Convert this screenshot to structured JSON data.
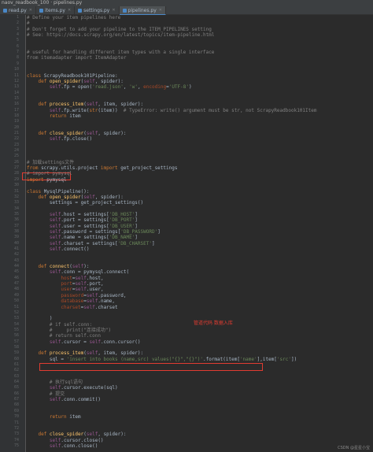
{
  "window": {
    "title": "naov_readbook_100  ·  pipelines.py"
  },
  "tabs": [
    {
      "label": "read.py",
      "active": false
    },
    {
      "label": "items.py",
      "active": false
    },
    {
      "label": "settings.py",
      "active": false
    },
    {
      "label": "pipelines.py",
      "active": true
    }
  ],
  "annotation": "管道代码 数据入库",
  "watermark": "CSDN @星星小宝",
  "lines": [
    {
      "n": "1",
      "t": [
        [
          "cmt",
          "# Define your item pipelines here"
        ]
      ]
    },
    {
      "n": "2",
      "t": [
        [
          "cmt",
          "#"
        ]
      ]
    },
    {
      "n": "3",
      "t": [
        [
          "cmt",
          "# Don't forget to add your pipeline to the ITEM_PIPELINES setting"
        ]
      ]
    },
    {
      "n": "4",
      "t": [
        [
          "cmt",
          "# See: https://docs.scrapy.org/en/latest/topics/item-pipeline.html"
        ]
      ]
    },
    {
      "n": "5",
      "t": []
    },
    {
      "n": "6",
      "t": []
    },
    {
      "n": "7",
      "t": [
        [
          "cmt",
          "# useful for handling different item types with a single interface"
        ]
      ]
    },
    {
      "n": "8",
      "t": [
        [
          "cmt",
          "from itemadapter import ItemAdapter"
        ]
      ]
    },
    {
      "n": "9",
      "t": []
    },
    {
      "n": "10",
      "t": []
    },
    {
      "n": "11",
      "t": [
        [
          "kw",
          "class "
        ],
        [
          "",
          "ScrapyReadbook101Pipeline:"
        ]
      ]
    },
    {
      "n": "12",
      "t": [
        [
          "",
          "    "
        ],
        [
          "kw",
          "def "
        ],
        [
          "fn",
          "open_spider"
        ],
        [
          "",
          "("
        ],
        [
          "slf",
          "self"
        ],
        [
          "",
          ", spider):"
        ]
      ]
    },
    {
      "n": "13",
      "t": [
        [
          "",
          "        "
        ],
        [
          "slf",
          "self"
        ],
        [
          "",
          ".fp = open("
        ],
        [
          "str",
          "'read.json'"
        ],
        [
          "",
          ", "
        ],
        [
          "str",
          "'w'"
        ],
        [
          "",
          ", "
        ],
        [
          "kwarg",
          "encoding"
        ],
        [
          "",
          "="
        ],
        [
          "str",
          "'UTF-8'"
        ],
        [
          "",
          ")"
        ]
      ]
    },
    {
      "n": "14",
      "t": []
    },
    {
      "n": "15",
      "t": []
    },
    {
      "n": "16",
      "t": [
        [
          "",
          "    "
        ],
        [
          "kw",
          "def "
        ],
        [
          "fn",
          "process_item"
        ],
        [
          "",
          "("
        ],
        [
          "slf",
          "self"
        ],
        [
          "",
          ", item, spider):"
        ]
      ]
    },
    {
      "n": "17",
      "t": [
        [
          "",
          "        "
        ],
        [
          "slf",
          "self"
        ],
        [
          "",
          ".fp.write("
        ],
        [
          "kw",
          "str"
        ],
        [
          "",
          "(item))  "
        ],
        [
          "cmt",
          "# TypeError: write() argument must be str, not ScrapyReadbook101Item"
        ]
      ]
    },
    {
      "n": "18",
      "t": [
        [
          "",
          "        "
        ],
        [
          "kw",
          "return "
        ],
        [
          "",
          "item"
        ]
      ]
    },
    {
      "n": "19",
      "t": []
    },
    {
      "n": "20",
      "t": []
    },
    {
      "n": "21",
      "t": [
        [
          "",
          "    "
        ],
        [
          "kw",
          "def "
        ],
        [
          "fn",
          "close_spider"
        ],
        [
          "",
          "("
        ],
        [
          "slf",
          "self"
        ],
        [
          "",
          ", spider):"
        ]
      ]
    },
    {
      "n": "22",
      "t": [
        [
          "",
          "        "
        ],
        [
          "slf",
          "self"
        ],
        [
          "",
          ".fp.close()"
        ]
      ]
    },
    {
      "n": "23",
      "t": []
    },
    {
      "n": "24",
      "t": []
    },
    {
      "n": "25",
      "t": []
    },
    {
      "n": "26",
      "t": [
        [
          "cmt",
          "# 加载settings文件"
        ]
      ]
    },
    {
      "n": "27",
      "t": [
        [
          "kw",
          "from "
        ],
        [
          "",
          "scrapy.utils.project "
        ],
        [
          "kw",
          "import "
        ],
        [
          "",
          "get_project_settings"
        ]
      ]
    },
    {
      "n": "28",
      "t": [
        [
          "cmt",
          "# import pymysql"
        ]
      ]
    },
    {
      "n": "29",
      "t": [
        [
          "kw",
          "import "
        ],
        [
          "",
          "pymysql"
        ]
      ]
    },
    {
      "n": "30",
      "t": []
    },
    {
      "n": "31",
      "t": [
        [
          "kw",
          "class "
        ],
        [
          "",
          "MysqlPipeline():"
        ]
      ]
    },
    {
      "n": "32",
      "t": [
        [
          "",
          "    "
        ],
        [
          "kw",
          "def "
        ],
        [
          "fn",
          "open_spider"
        ],
        [
          "",
          "("
        ],
        [
          "slf",
          "self"
        ],
        [
          "",
          ", spider):"
        ]
      ]
    },
    {
      "n": "33",
      "t": [
        [
          "",
          "        settings = get_project_settings()"
        ]
      ]
    },
    {
      "n": "34",
      "t": []
    },
    {
      "n": "35",
      "t": [
        [
          "",
          "        "
        ],
        [
          "slf",
          "self"
        ],
        [
          "",
          ".host = settings["
        ],
        [
          "str",
          "'DB_HOST'"
        ],
        [
          "",
          "]"
        ]
      ]
    },
    {
      "n": "36",
      "t": [
        [
          "",
          "        "
        ],
        [
          "slf",
          "self"
        ],
        [
          "",
          ".port = settings["
        ],
        [
          "str",
          "'DB_PORT'"
        ],
        [
          "",
          "]"
        ]
      ]
    },
    {
      "n": "37",
      "t": [
        [
          "",
          "        "
        ],
        [
          "slf",
          "self"
        ],
        [
          "",
          ".user = settings["
        ],
        [
          "str",
          "'DB_USER'"
        ],
        [
          "",
          "]"
        ]
      ]
    },
    {
      "n": "38",
      "t": [
        [
          "",
          "        "
        ],
        [
          "slf",
          "self"
        ],
        [
          "",
          ".password = settings["
        ],
        [
          "str",
          "'DB_PASSWORD'"
        ],
        [
          "",
          "]"
        ]
      ]
    },
    {
      "n": "39",
      "t": [
        [
          "",
          "        "
        ],
        [
          "slf",
          "self"
        ],
        [
          "",
          ".name = settings["
        ],
        [
          "str",
          "'DB_NAME'"
        ],
        [
          "",
          "]"
        ]
      ]
    },
    {
      "n": "40",
      "t": [
        [
          "",
          "        "
        ],
        [
          "slf",
          "self"
        ],
        [
          "",
          ".charset = settings["
        ],
        [
          "str",
          "'DB_CHARSET'"
        ],
        [
          "",
          "]"
        ]
      ]
    },
    {
      "n": "41",
      "t": [
        [
          "",
          "        "
        ],
        [
          "slf",
          "self"
        ],
        [
          "",
          ".connect()"
        ]
      ]
    },
    {
      "n": "42",
      "t": []
    },
    {
      "n": "43",
      "t": []
    },
    {
      "n": "44",
      "t": [
        [
          "",
          "    "
        ],
        [
          "kw",
          "def "
        ],
        [
          "fn",
          "connect"
        ],
        [
          "",
          "("
        ],
        [
          "slf",
          "self"
        ],
        [
          "",
          "):"
        ]
      ]
    },
    {
      "n": "45",
      "t": [
        [
          "",
          "        "
        ],
        [
          "slf",
          "self"
        ],
        [
          "",
          ".conn = pymysql.connect("
        ]
      ]
    },
    {
      "n": "46",
      "t": [
        [
          "",
          "            "
        ],
        [
          "kwarg",
          "host"
        ],
        [
          "",
          "="
        ],
        [
          "slf",
          "self"
        ],
        [
          "",
          ".host,"
        ]
      ]
    },
    {
      "n": "47",
      "t": [
        [
          "",
          "            "
        ],
        [
          "kwarg",
          "port"
        ],
        [
          "",
          "="
        ],
        [
          "slf",
          "self"
        ],
        [
          "",
          ".port,"
        ]
      ]
    },
    {
      "n": "48",
      "t": [
        [
          "",
          "            "
        ],
        [
          "kwarg",
          "user"
        ],
        [
          "",
          "="
        ],
        [
          "slf",
          "self"
        ],
        [
          "",
          ".user,"
        ]
      ]
    },
    {
      "n": "49",
      "t": [
        [
          "",
          "            "
        ],
        [
          "kwarg",
          "password"
        ],
        [
          "",
          "="
        ],
        [
          "slf",
          "self"
        ],
        [
          "",
          ".password,"
        ]
      ]
    },
    {
      "n": "50",
      "t": [
        [
          "",
          "            "
        ],
        [
          "kwarg",
          "database"
        ],
        [
          "",
          "="
        ],
        [
          "slf",
          "self"
        ],
        [
          "",
          ".name,"
        ]
      ]
    },
    {
      "n": "51",
      "t": [
        [
          "",
          "            "
        ],
        [
          "kwarg",
          "charset"
        ],
        [
          "",
          "="
        ],
        [
          "slf",
          "self"
        ],
        [
          "",
          ".charset"
        ]
      ]
    },
    {
      "n": "52",
      "t": []
    },
    {
      "n": "53",
      "t": [
        [
          "",
          "        )"
        ]
      ]
    },
    {
      "n": "54",
      "t": [
        [
          "",
          "        "
        ],
        [
          "cmt",
          "# if self.conn:"
        ]
      ]
    },
    {
      "n": "55",
      "t": [
        [
          "",
          "        "
        ],
        [
          "cmt",
          "#     print(\"连接成功\")"
        ]
      ]
    },
    {
      "n": "56",
      "t": [
        [
          "",
          "        "
        ],
        [
          "cmt",
          "# return self.conn"
        ]
      ]
    },
    {
      "n": "57",
      "t": [
        [
          "",
          "        "
        ],
        [
          "slf",
          "self"
        ],
        [
          "",
          ".cursor = "
        ],
        [
          "slf",
          "self"
        ],
        [
          "",
          ".conn.cursor()"
        ]
      ]
    },
    {
      "n": "58",
      "t": []
    },
    {
      "n": "59",
      "t": [
        [
          "",
          "    "
        ],
        [
          "kw",
          "def "
        ],
        [
          "fn",
          "process_item"
        ],
        [
          "",
          "("
        ],
        [
          "slf",
          "self"
        ],
        [
          "",
          ", item, spider):"
        ]
      ]
    },
    {
      "n": "60",
      "t": [
        [
          "",
          "        sql = "
        ],
        [
          "str",
          "'insert into books (name,src) values(\"{}\",\"{}\")'"
        ],
        [
          "",
          ".format(item["
        ],
        [
          "str",
          "'name'"
        ],
        [
          "",
          "],item["
        ],
        [
          "str",
          "'src'"
        ],
        [
          "",
          "])"
        ]
      ]
    },
    {
      "n": "61",
      "t": []
    },
    {
      "n": "62",
      "t": []
    },
    {
      "n": "63",
      "t": []
    },
    {
      "n": "64",
      "t": [
        [
          "",
          "        "
        ],
        [
          "cmt",
          "# 执行sql语句"
        ]
      ]
    },
    {
      "n": "65",
      "t": [
        [
          "",
          "        "
        ],
        [
          "slf",
          "self"
        ],
        [
          "",
          ".cursor.execute(sql)"
        ]
      ]
    },
    {
      "n": "66",
      "t": [
        [
          "",
          "        "
        ],
        [
          "cmt",
          "# 提交"
        ]
      ]
    },
    {
      "n": "67",
      "t": [
        [
          "",
          "        "
        ],
        [
          "slf",
          "self"
        ],
        [
          "",
          ".conn.commit()"
        ]
      ]
    },
    {
      "n": "68",
      "t": []
    },
    {
      "n": "69",
      "t": []
    },
    {
      "n": "70",
      "t": [
        [
          "",
          "        "
        ],
        [
          "kw",
          "return "
        ],
        [
          "",
          "item"
        ]
      ]
    },
    {
      "n": "71",
      "t": []
    },
    {
      "n": "72",
      "t": []
    },
    {
      "n": "73",
      "t": [
        [
          "",
          "    "
        ],
        [
          "kw",
          "def "
        ],
        [
          "fn",
          "close_spider"
        ],
        [
          "",
          "("
        ],
        [
          "slf",
          "self"
        ],
        [
          "",
          ", spider):"
        ]
      ]
    },
    {
      "n": "74",
      "t": [
        [
          "",
          "        "
        ],
        [
          "slf",
          "self"
        ],
        [
          "",
          ".cursor.close()"
        ]
      ]
    },
    {
      "n": "75",
      "t": [
        [
          "",
          "        "
        ],
        [
          "slf",
          "self"
        ],
        [
          "",
          ".conn.close()"
        ]
      ]
    }
  ]
}
